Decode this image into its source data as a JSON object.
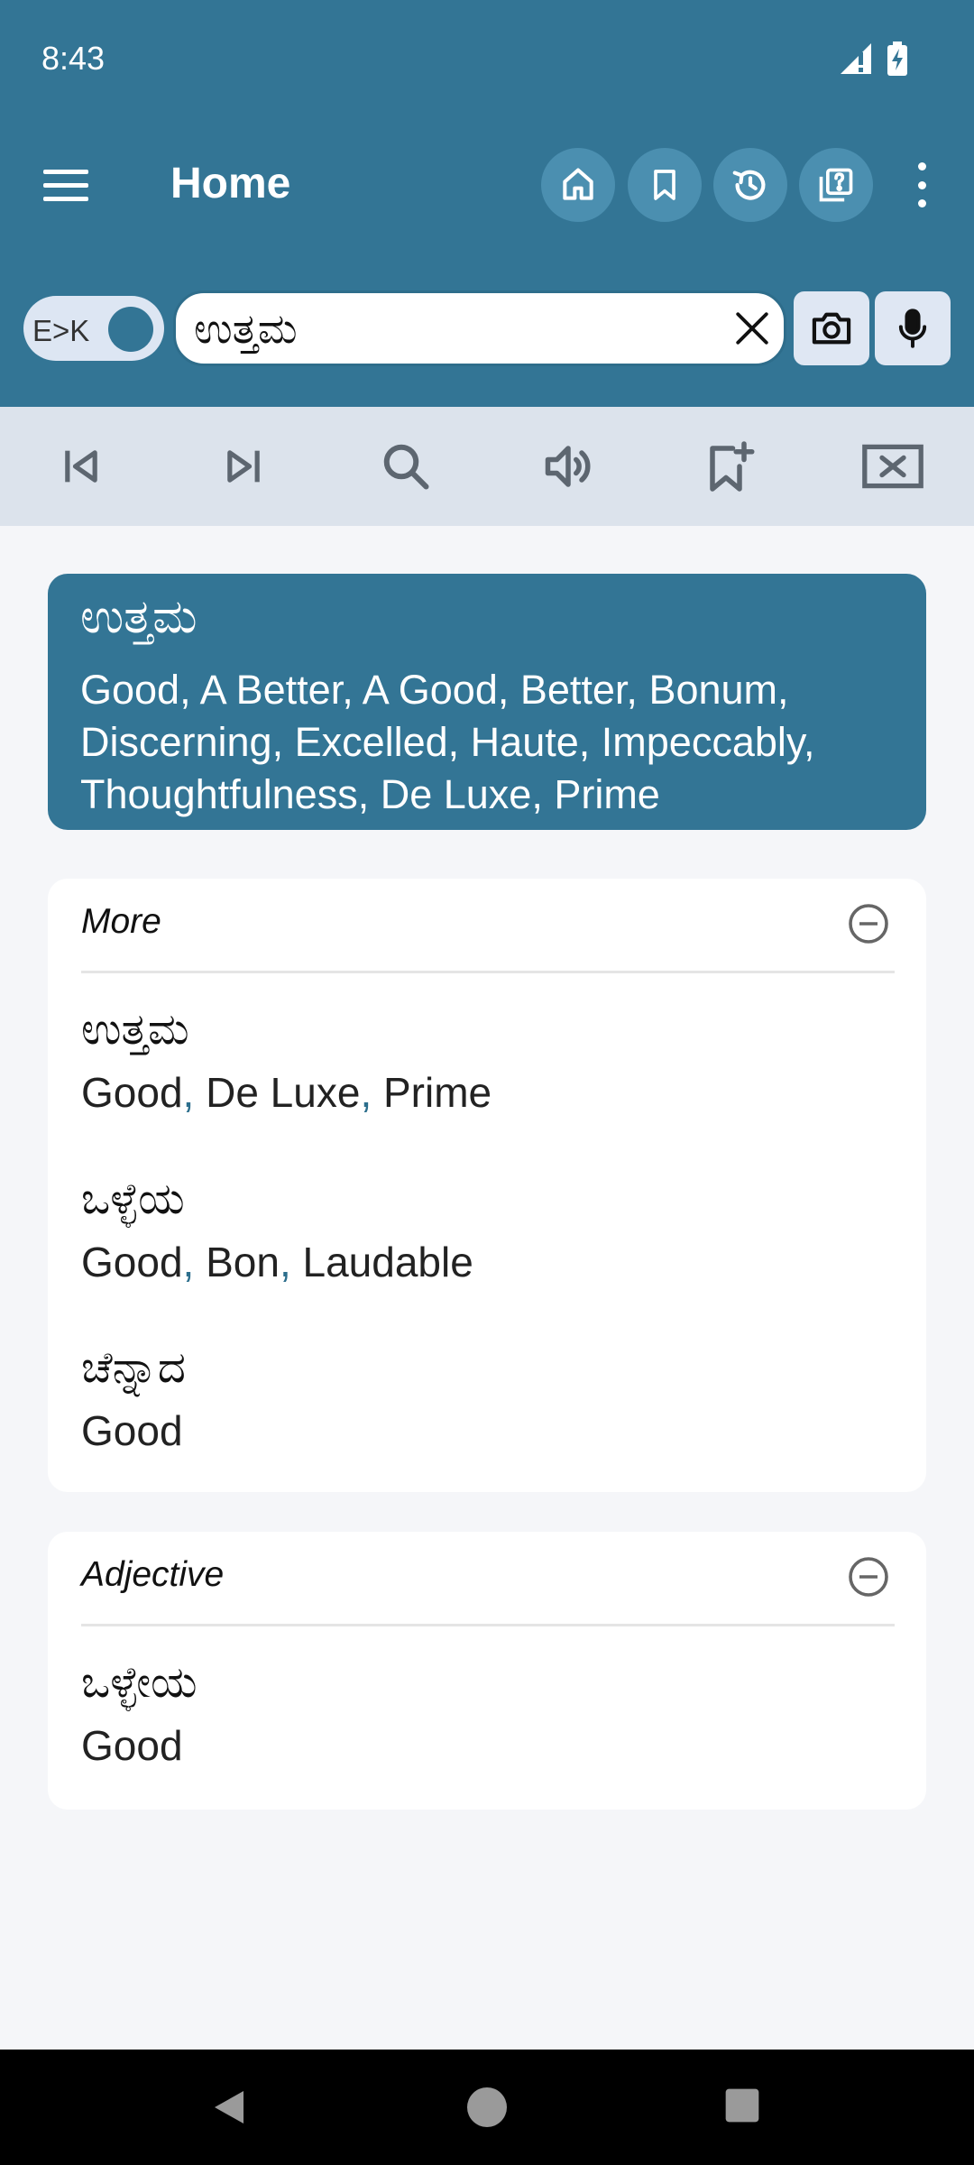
{
  "status_bar": {
    "time": "8:43"
  },
  "header": {
    "title": "Home"
  },
  "search": {
    "direction_label": "E>K",
    "query": "ಉತ್ತಮ"
  },
  "main_result": {
    "word": "ಉತ್ತಮ",
    "translations": "Good, A Better, A Good, Better, Bonum, Discerning, Excelled, Haute, Impeccably, Thoughtfulness, De Luxe, Prime"
  },
  "sections": [
    {
      "heading": "More",
      "entries": [
        {
          "word": "ಉತ್ತಮ",
          "translations": [
            "Good",
            "De Luxe",
            "Prime"
          ]
        },
        {
          "word": "ಒಳ್ಳೆಯ",
          "translations": [
            "Good",
            "Bon",
            "Laudable"
          ]
        },
        {
          "word": "ಚೆನ್ನಾದ",
          "translations": [
            "Good"
          ]
        }
      ]
    },
    {
      "heading": "Adjective",
      "entries": [
        {
          "word": "ಒಳ್ಳೇಯ",
          "translations": [
            "Good"
          ]
        }
      ]
    }
  ],
  "colors": {
    "primary": "#337595",
    "toolbar_bg": "#dce3ec",
    "page_bg": "#f5f6f9",
    "comma": "#2c6e8c"
  }
}
